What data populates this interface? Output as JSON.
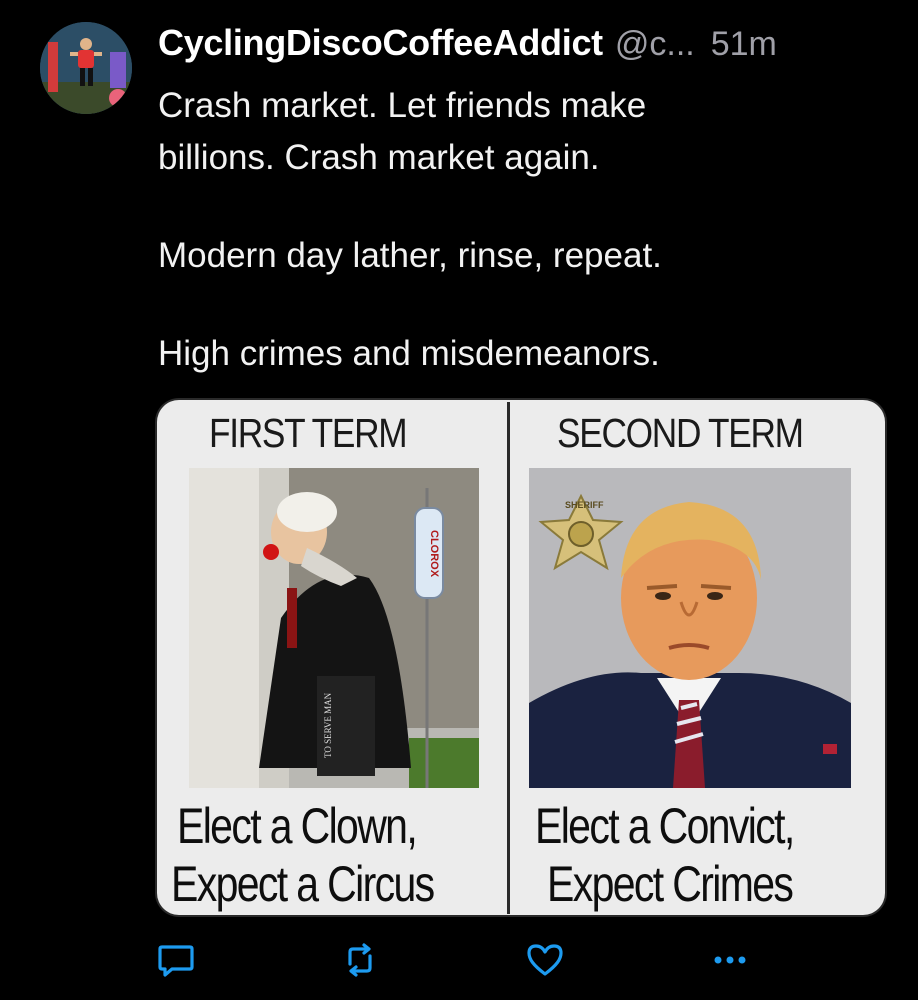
{
  "post": {
    "author": {
      "display_name": "CyclingDiscoCoffeeAddict",
      "handle": "@c...",
      "time": "51m",
      "avatar_icon": "cyclist-avatar"
    },
    "text_lines": [
      "Crash market. Let friends make",
      "billions. Crash market again.",
      "Modern day lather, rinse, repeat.",
      "High crimes and misdemeanors."
    ],
    "media": {
      "left_panel": {
        "title": "FIRST TERM",
        "caption_line1": "Elect a Clown,",
        "caption_line2": "Expect a Circus",
        "iv_bag_label": "CLOROX",
        "folder_label": "TO SERVE MAN"
      },
      "right_panel": {
        "title": "SECOND TERM",
        "caption_line1": "Elect a Convict,",
        "caption_line2": "Expect Crimes",
        "badge_label": "SHERIFF"
      }
    },
    "actions": {
      "reply_icon": "speech-bubble-icon",
      "repost_icon": "repost-arrows-icon",
      "like_icon": "heart-icon",
      "more_icon": "ellipsis-icon"
    },
    "colors": {
      "background": "#000000",
      "text": "#f2f2f2",
      "muted": "#a0a0a8",
      "card": "#ececec",
      "accent": "#1d9bf0"
    }
  }
}
